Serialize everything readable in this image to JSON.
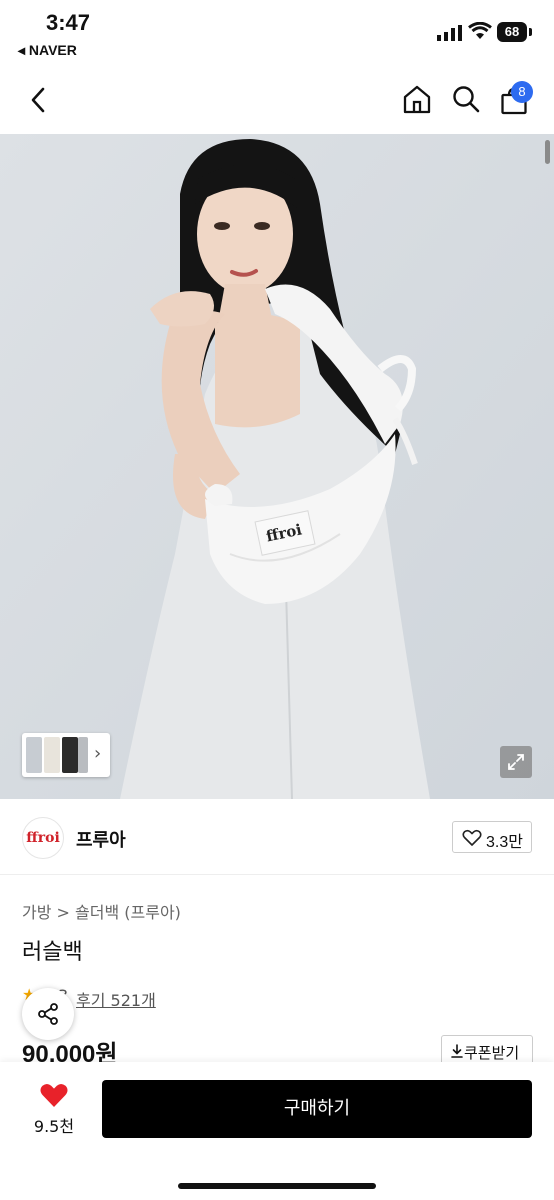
{
  "status_bar": {
    "time": "3:47",
    "back_app": "◂ NAVER",
    "battery": "68"
  },
  "nav": {
    "cart_count": "8"
  },
  "brand": {
    "logo_text": "ffroi",
    "name": "프루아",
    "likes": "3.3만"
  },
  "product": {
    "breadcrumb": "가방 > 숄더백 (프루아)",
    "name": "러슬백",
    "rating_fragment": "3",
    "review_link": "후기 521개",
    "price": "90,000원",
    "coupon_label": "쿠폰받기",
    "bag_label": "ffroi"
  },
  "bottom": {
    "wish_count": "9.5천",
    "buy_label": "구매하기"
  },
  "colors": {
    "buy": "#000000",
    "badge": "#2d6bf0",
    "heart": "#e8222a",
    "brand": "#d0222a"
  }
}
